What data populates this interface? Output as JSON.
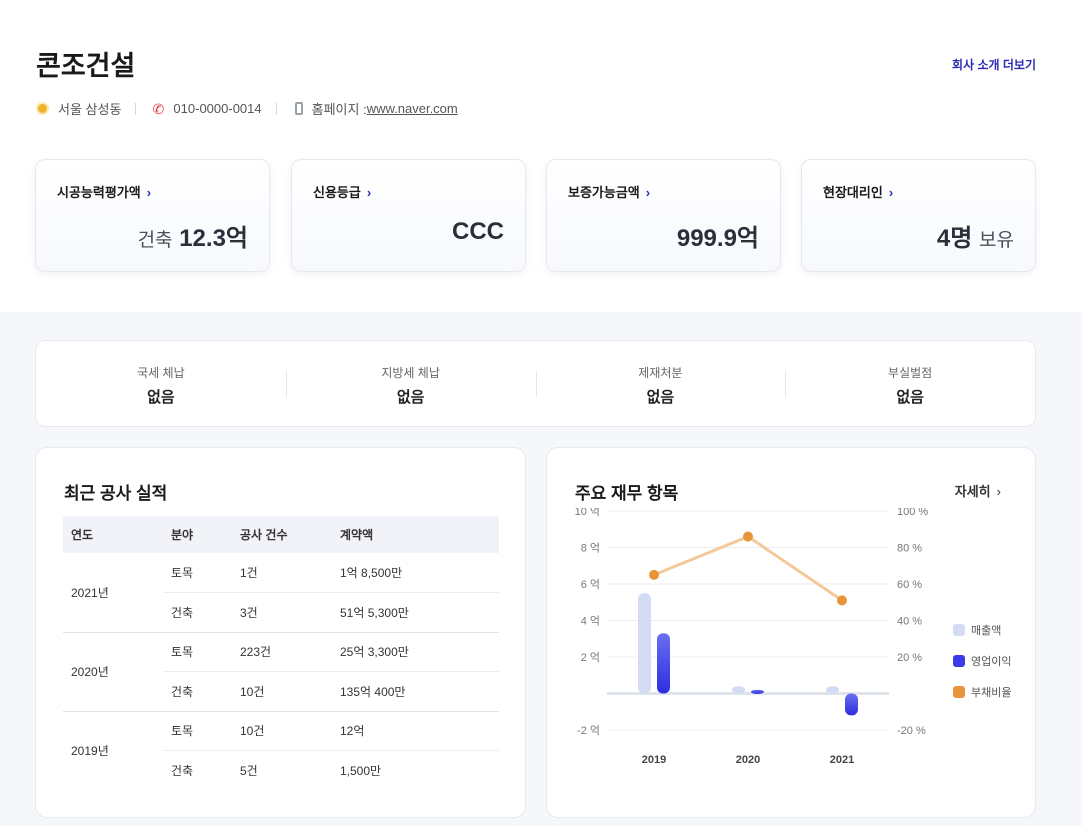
{
  "company": {
    "name": "콘조건설",
    "more_link": "회사 소개 더보기",
    "location": "서울 삼성동",
    "phone": "010-0000-0014",
    "homepage_label": "홈페이지 :",
    "homepage_url": "www.naver.com"
  },
  "kpis": [
    {
      "title": "시공능력평가액",
      "prefix": "건축",
      "value": "12.3억",
      "suffix": ""
    },
    {
      "title": "신용등급",
      "prefix": "",
      "value": "CCC",
      "suffix": ""
    },
    {
      "title": "보증가능금액",
      "prefix": "",
      "value": "999.9억",
      "suffix": ""
    },
    {
      "title": "현장대리인",
      "prefix": "",
      "value": "4명",
      "suffix": "보유"
    }
  ],
  "status": [
    {
      "label": "국세 체납",
      "value": "없음"
    },
    {
      "label": "지방세 체납",
      "value": "없음"
    },
    {
      "label": "제재처분",
      "value": "없음"
    },
    {
      "label": "부실벌점",
      "value": "없음"
    }
  ],
  "performance": {
    "title": "최근 공사 실적",
    "headers": [
      "연도",
      "분야",
      "공사 건수",
      "계약액"
    ],
    "groups": [
      {
        "year": "2021년",
        "rows": [
          {
            "field": "토목",
            "count": "1건",
            "amount": "1억 8,500만"
          },
          {
            "field": "건축",
            "count": "3건",
            "amount": "51억 5,300만"
          }
        ]
      },
      {
        "year": "2020년",
        "rows": [
          {
            "field": "토목",
            "count": "223건",
            "amount": "25억 3,300만"
          },
          {
            "field": "건축",
            "count": "10건",
            "amount": "135억 400만"
          }
        ]
      },
      {
        "year": "2019년",
        "rows": [
          {
            "field": "토목",
            "count": "10건",
            "amount": "12억"
          },
          {
            "field": "건축",
            "count": "5건",
            "amount": "1,500만"
          }
        ]
      }
    ]
  },
  "finance": {
    "title": "주요 재무 항목",
    "detail_link": "자세히"
  },
  "chart_data": {
    "type": "bar",
    "categories": [
      "2019",
      "2020",
      "2021"
    ],
    "series": [
      {
        "name": "매출액",
        "type": "bar",
        "axis": "left",
        "color": "#d3dbf5",
        "values": [
          5.5,
          0.4,
          0.4
        ]
      },
      {
        "name": "영업이익",
        "type": "bar",
        "axis": "left",
        "color": "#3a3ae8",
        "values": [
          3.3,
          0.2,
          -1.2
        ]
      },
      {
        "name": "부채비율",
        "type": "line",
        "axis": "right",
        "color": "#e8953a",
        "values": [
          65,
          86,
          51
        ]
      }
    ],
    "y_left": {
      "ticks": [
        "10 억",
        "8 억",
        "6 억",
        "4 억",
        "2 억",
        "-2 억"
      ],
      "tick_values": [
        10,
        8,
        6,
        4,
        2,
        -2
      ],
      "min": -2,
      "max": 10
    },
    "y_right": {
      "ticks": [
        "100 %",
        "80 %",
        "60 %",
        "40 %",
        "20 %",
        "-20 %"
      ],
      "tick_values": [
        100,
        80,
        60,
        40,
        20,
        -20
      ],
      "min": -20,
      "max": 100
    },
    "grid": true,
    "legend_position": "right"
  }
}
